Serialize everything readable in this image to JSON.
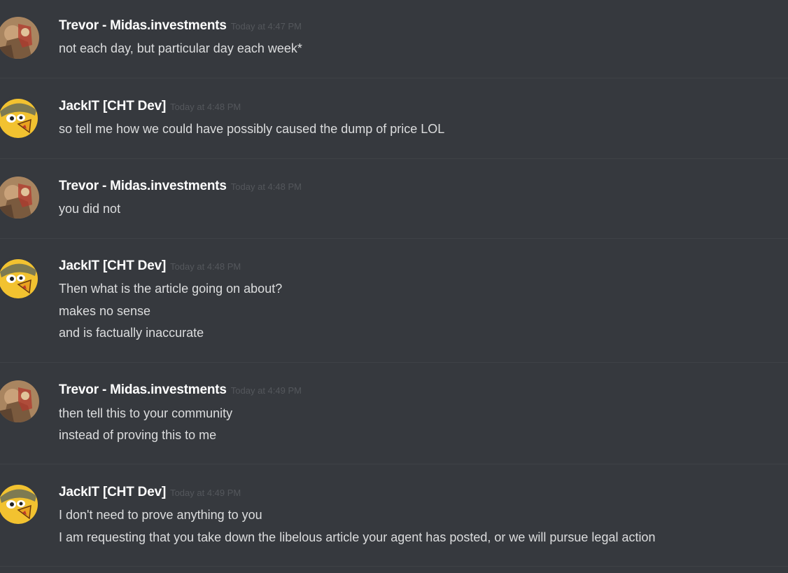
{
  "messages": [
    {
      "author": "Trevor - Midas.investments",
      "avatar_icon": "painting-avatar-icon",
      "timestamp": "Today at 4:47 PM",
      "lines": [
        "not each day, but particular day each week*"
      ]
    },
    {
      "author": "JackIT [CHT Dev]",
      "avatar_icon": "cartoon-dog-avatar-icon",
      "timestamp": "Today at 4:48 PM",
      "lines": [
        "so tell me how we could have possibly caused the dump of price LOL"
      ]
    },
    {
      "author": "Trevor - Midas.investments",
      "avatar_icon": "painting-avatar-icon",
      "timestamp": "Today at 4:48 PM",
      "lines": [
        "you did not"
      ]
    },
    {
      "author": "JackIT [CHT Dev]",
      "avatar_icon": "cartoon-dog-avatar-icon",
      "timestamp": "Today at 4:48 PM",
      "lines": [
        "Then what is the article going on about?",
        "makes no sense",
        "and is factually inaccurate"
      ]
    },
    {
      "author": "Trevor - Midas.investments",
      "avatar_icon": "painting-avatar-icon",
      "timestamp": "Today at 4:49 PM",
      "lines": [
        "then tell this to your community",
        "instead of proving this to me"
      ]
    },
    {
      "author": "JackIT [CHT Dev]",
      "avatar_icon": "cartoon-dog-avatar-icon",
      "timestamp": "Today at 4:49 PM",
      "lines": [
        "I don't need to prove anything to you",
        "I am requesting that you take down the libelous article your agent has posted, or we will pursue legal action"
      ]
    }
  ],
  "colors": {
    "background": "#36393e",
    "username": "#ffffff",
    "message_text": "#dcddde",
    "timestamp": "#54575c",
    "divider": "#3f4246"
  }
}
